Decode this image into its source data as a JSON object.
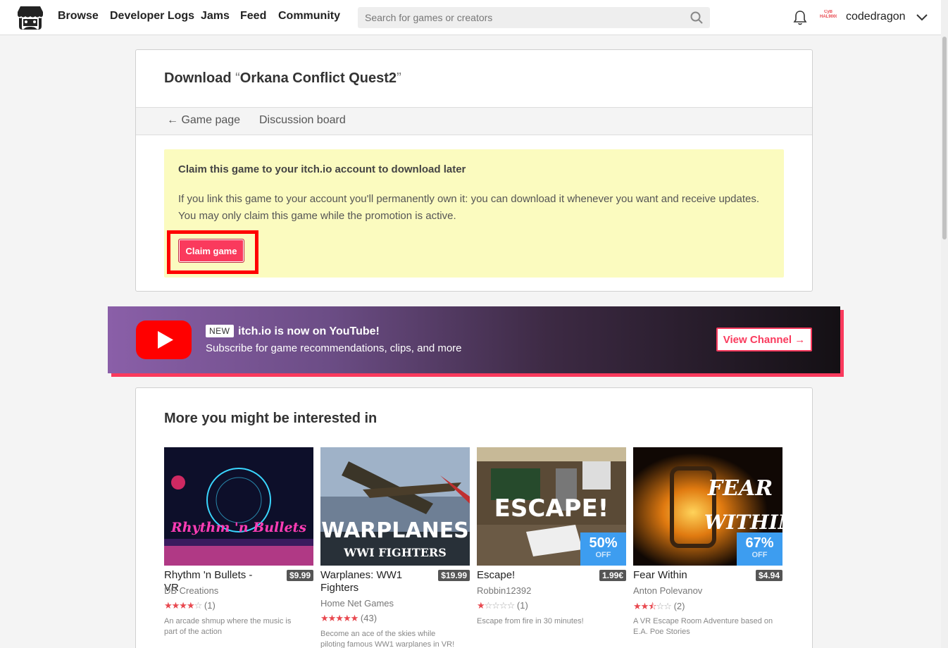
{
  "header": {
    "nav": [
      "Browse",
      "Developer Logs",
      "Jams",
      "Feed",
      "Community"
    ],
    "search_placeholder": "Search for games or creators",
    "avatar_text": "CyB HAL9000",
    "username": "codedragon"
  },
  "download": {
    "title_prefix": "Download ",
    "quote_open": "“",
    "game_name": "Orkana Conflict Quest2",
    "quote_close": "”",
    "nav_back": "← Game page",
    "nav_discussion": "Discussion board",
    "claim_heading": "Claim this game to your itch.io account to download later",
    "claim_text": "If you link this game to your account you'll permanently own it: you can download it whenever you want and receive updates. You may only claim this game while the promotion is active.",
    "claim_button": "Claim game"
  },
  "youtube": {
    "badge": "NEW",
    "title": "itch.io is now on YouTube!",
    "subtitle": "Subscribe for game recommendations, clips, and more",
    "button": "View Channel →"
  },
  "more": {
    "title": "More you might be interested in",
    "games": [
      {
        "title": "Rhythm 'n Bullets - VR",
        "price": "$9.99",
        "author": "DB Creations",
        "stars": 4,
        "half": false,
        "count": "(1)",
        "desc": "An arcade shmup where the music is part of the action",
        "thumb_text": "Rhythm 'n Bullets"
      },
      {
        "title": "Warplanes: WW1 Fighters",
        "price": "$19.99",
        "author": "Home Net Games",
        "stars": 5,
        "half": false,
        "count": "(43)",
        "desc": "Become an ace of the skies while piloting famous WW1 warplanes in VR!",
        "thumb_text": "WARPLANES",
        "thumb_sub": "WWI FIGHTERS"
      },
      {
        "title": "Escape!",
        "price": "1.99€",
        "author": "Robbin12392",
        "stars": 1,
        "half": false,
        "count": "(1)",
        "desc": "Escape from fire in 30 minutes!",
        "thumb_text": "ESCAPE!",
        "sale_pct": "50%",
        "sale_off": "OFF"
      },
      {
        "title": "Fear Within",
        "price": "$4.94",
        "author": "Anton Polevanov",
        "stars": 2,
        "half": true,
        "count": "(2)",
        "desc": "A VR Escape Room Adventure based on E.A. Poe Stories",
        "thumb_text": "FEAR",
        "thumb_sub": "WITHIN",
        "sale_pct": "67%",
        "sale_off": "OFF"
      }
    ]
  },
  "colors": {
    "accent": "#fa3a5d",
    "claim_bg": "#fbfbbf",
    "sale": "#3d9df0",
    "highlight": "#ff0000"
  }
}
